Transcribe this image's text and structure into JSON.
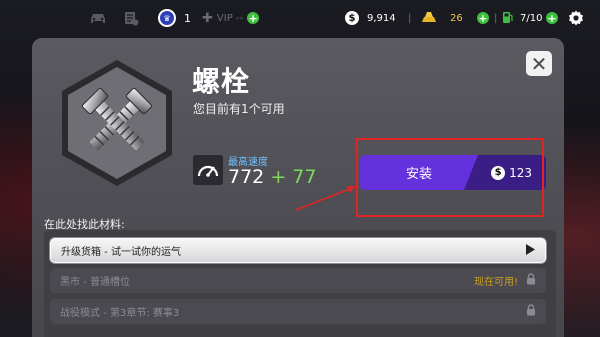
{
  "topbar": {
    "level": "1",
    "vip_label": "VIP --",
    "cash": "9,914",
    "cash_symbol": "$",
    "gold": "26",
    "fuel": "7/10"
  },
  "item": {
    "name": "螺栓",
    "owned_text": "您目前有1个可用",
    "stat_label": "最高速度",
    "stat_base": "772",
    "stat_bonus": "+ 77"
  },
  "install": {
    "label": "安装",
    "currency_symbol": "$",
    "price": "123"
  },
  "sources": {
    "heading": "在此处找此材料:",
    "rows": [
      {
        "label": "升级货箱 - 试一试你的运气",
        "status": ""
      },
      {
        "label": "黑市 - 普通槽位",
        "status": "现在可用!"
      },
      {
        "label": "战役模式 - 第3章节: 赛事3",
        "status": ""
      }
    ]
  },
  "close_label": "✕",
  "colors": {
    "install_purple": "#6531dc",
    "install_dark": "#3a1e86",
    "plus_green": "#3fbf3f",
    "stat_blue": "#6fc3ff",
    "bonus_green": "#7cdc5a",
    "annotation_red": "#e02424"
  },
  "icons": [
    "garage-icon",
    "checklist-icon",
    "crown-icon",
    "vip-icon",
    "cash-icon",
    "gold-icon",
    "fuel-icon",
    "settings-icon",
    "speedometer-icon",
    "bolts-icon",
    "play-icon",
    "lock-icon"
  ]
}
